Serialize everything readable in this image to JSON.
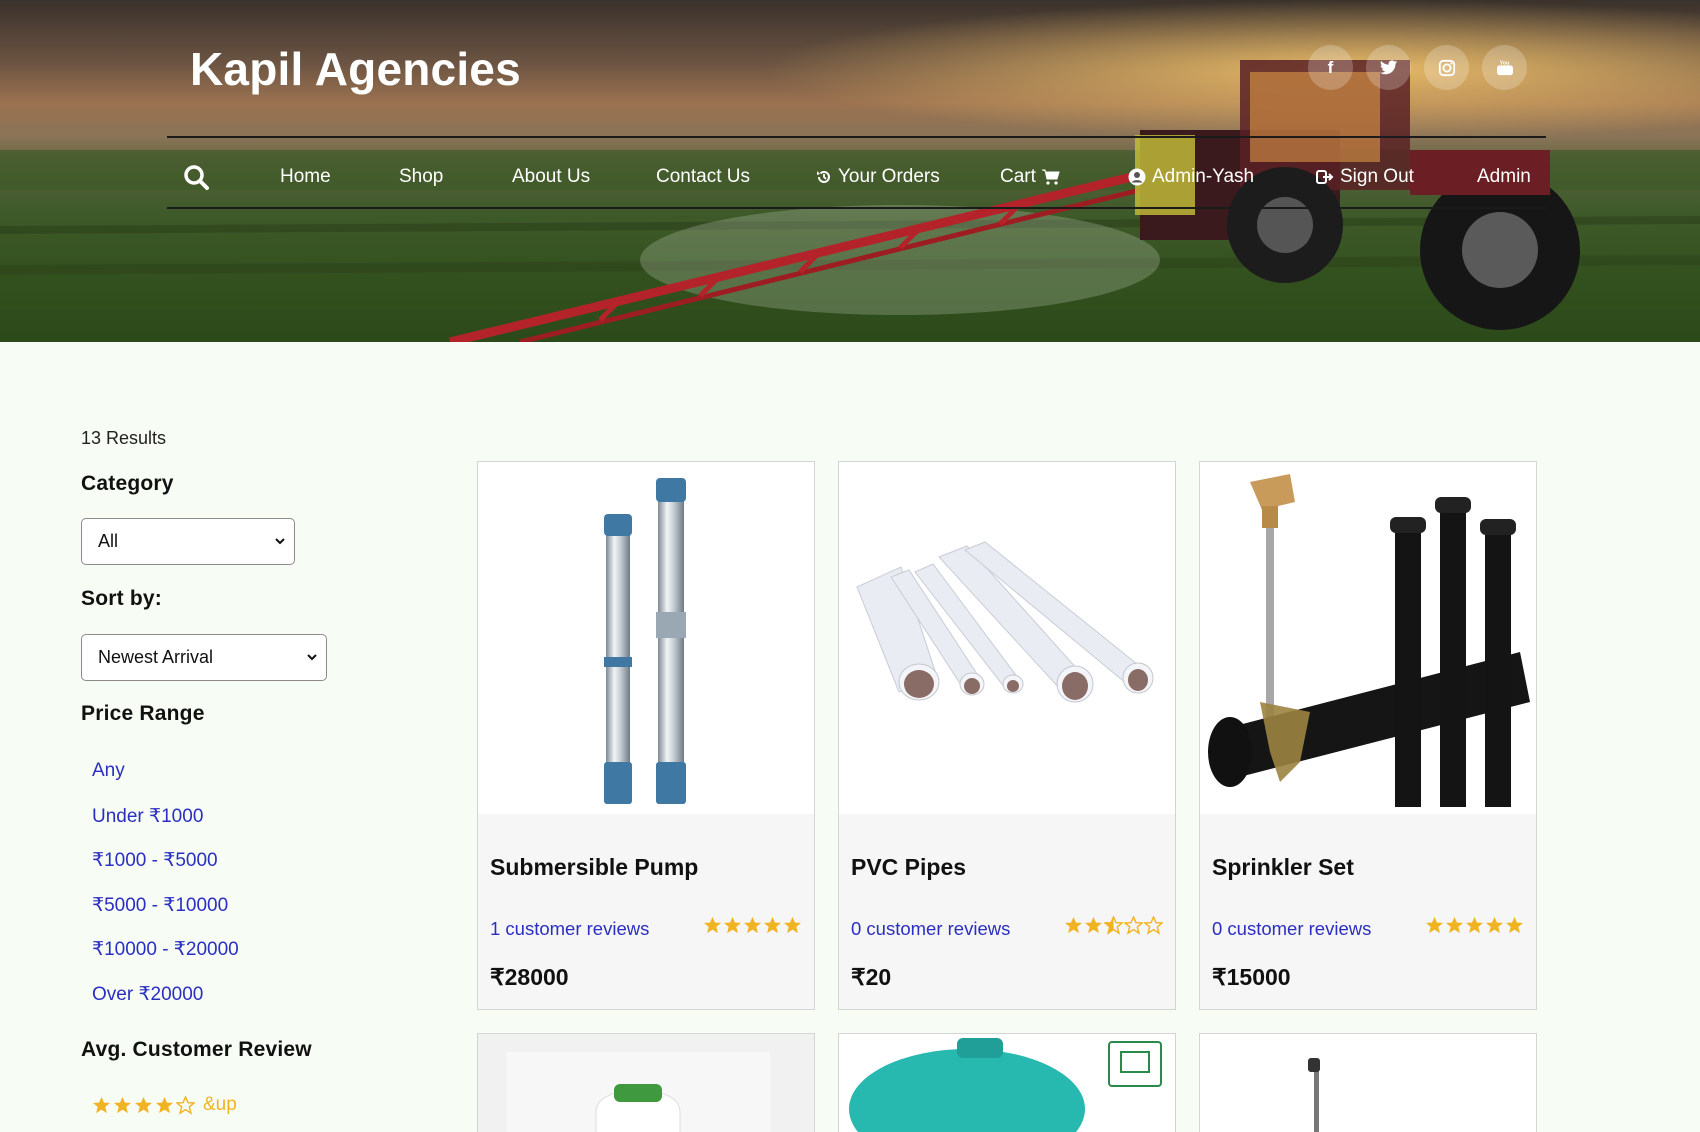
{
  "header": {
    "brand": "Kapil Agencies",
    "social_icons": [
      "facebook-icon",
      "twitter-icon",
      "instagram-icon",
      "youtube-icon"
    ],
    "nav": {
      "home": "Home",
      "shop": "Shop",
      "about": "About Us",
      "contact": "Contact Us",
      "orders": "Your Orders",
      "cart": "Cart",
      "user": "Admin-Yash",
      "signout": "Sign Out",
      "admin": "Admin"
    }
  },
  "sidebar": {
    "results": "13 Results",
    "category_heading": "Category",
    "category_selected": "All",
    "sort_heading": "Sort by:",
    "sort_selected": "Newest Arrival",
    "price_heading": "Price Range",
    "price_ranges": [
      "Any",
      "Under ₹1000",
      "₹1000 - ₹5000",
      "₹5000 - ₹10000",
      "₹10000 - ₹20000",
      "Over ₹20000"
    ],
    "review_heading": "Avg. Customer Review",
    "review_filter": {
      "stars": 4,
      "label": "&up"
    }
  },
  "products": [
    {
      "name": "Submersible Pump",
      "reviews": "1 customer reviews",
      "rating": 5,
      "price": "₹28000"
    },
    {
      "name": "PVC Pipes",
      "reviews": "0 customer reviews",
      "rating": 2.5,
      "price": "₹20"
    },
    {
      "name": "Sprinkler Set",
      "reviews": "0 customer reviews",
      "rating": 5,
      "price": "₹15000"
    }
  ],
  "colors": {
    "link": "#2b2ec2",
    "star": "#f0b322",
    "page_bg": "#f7fdf4"
  }
}
